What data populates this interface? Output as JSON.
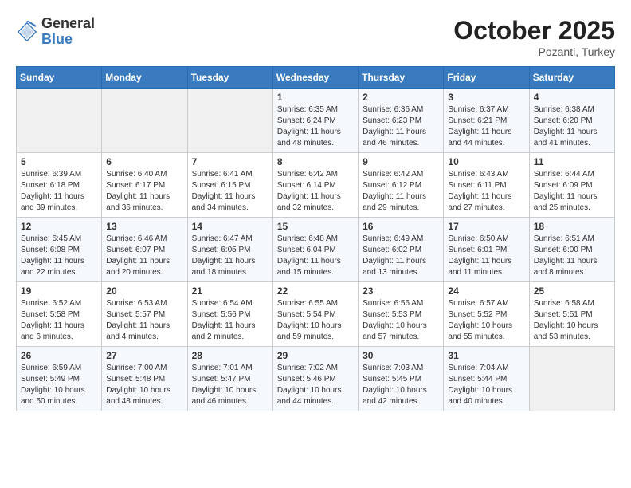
{
  "header": {
    "logo_line1": "General",
    "logo_line2": "Blue",
    "month_title": "October 2025",
    "subtitle": "Pozanti, Turkey"
  },
  "days_of_week": [
    "Sunday",
    "Monday",
    "Tuesday",
    "Wednesday",
    "Thursday",
    "Friday",
    "Saturday"
  ],
  "weeks": [
    [
      {
        "day": "",
        "info": ""
      },
      {
        "day": "",
        "info": ""
      },
      {
        "day": "",
        "info": ""
      },
      {
        "day": "1",
        "info": "Sunrise: 6:35 AM\nSunset: 6:24 PM\nDaylight: 11 hours\nand 48 minutes."
      },
      {
        "day": "2",
        "info": "Sunrise: 6:36 AM\nSunset: 6:23 PM\nDaylight: 11 hours\nand 46 minutes."
      },
      {
        "day": "3",
        "info": "Sunrise: 6:37 AM\nSunset: 6:21 PM\nDaylight: 11 hours\nand 44 minutes."
      },
      {
        "day": "4",
        "info": "Sunrise: 6:38 AM\nSunset: 6:20 PM\nDaylight: 11 hours\nand 41 minutes."
      }
    ],
    [
      {
        "day": "5",
        "info": "Sunrise: 6:39 AM\nSunset: 6:18 PM\nDaylight: 11 hours\nand 39 minutes."
      },
      {
        "day": "6",
        "info": "Sunrise: 6:40 AM\nSunset: 6:17 PM\nDaylight: 11 hours\nand 36 minutes."
      },
      {
        "day": "7",
        "info": "Sunrise: 6:41 AM\nSunset: 6:15 PM\nDaylight: 11 hours\nand 34 minutes."
      },
      {
        "day": "8",
        "info": "Sunrise: 6:42 AM\nSunset: 6:14 PM\nDaylight: 11 hours\nand 32 minutes."
      },
      {
        "day": "9",
        "info": "Sunrise: 6:42 AM\nSunset: 6:12 PM\nDaylight: 11 hours\nand 29 minutes."
      },
      {
        "day": "10",
        "info": "Sunrise: 6:43 AM\nSunset: 6:11 PM\nDaylight: 11 hours\nand 27 minutes."
      },
      {
        "day": "11",
        "info": "Sunrise: 6:44 AM\nSunset: 6:09 PM\nDaylight: 11 hours\nand 25 minutes."
      }
    ],
    [
      {
        "day": "12",
        "info": "Sunrise: 6:45 AM\nSunset: 6:08 PM\nDaylight: 11 hours\nand 22 minutes."
      },
      {
        "day": "13",
        "info": "Sunrise: 6:46 AM\nSunset: 6:07 PM\nDaylight: 11 hours\nand 20 minutes."
      },
      {
        "day": "14",
        "info": "Sunrise: 6:47 AM\nSunset: 6:05 PM\nDaylight: 11 hours\nand 18 minutes."
      },
      {
        "day": "15",
        "info": "Sunrise: 6:48 AM\nSunset: 6:04 PM\nDaylight: 11 hours\nand 15 minutes."
      },
      {
        "day": "16",
        "info": "Sunrise: 6:49 AM\nSunset: 6:02 PM\nDaylight: 11 hours\nand 13 minutes."
      },
      {
        "day": "17",
        "info": "Sunrise: 6:50 AM\nSunset: 6:01 PM\nDaylight: 11 hours\nand 11 minutes."
      },
      {
        "day": "18",
        "info": "Sunrise: 6:51 AM\nSunset: 6:00 PM\nDaylight: 11 hours\nand 8 minutes."
      }
    ],
    [
      {
        "day": "19",
        "info": "Sunrise: 6:52 AM\nSunset: 5:58 PM\nDaylight: 11 hours\nand 6 minutes."
      },
      {
        "day": "20",
        "info": "Sunrise: 6:53 AM\nSunset: 5:57 PM\nDaylight: 11 hours\nand 4 minutes."
      },
      {
        "day": "21",
        "info": "Sunrise: 6:54 AM\nSunset: 5:56 PM\nDaylight: 11 hours\nand 2 minutes."
      },
      {
        "day": "22",
        "info": "Sunrise: 6:55 AM\nSunset: 5:54 PM\nDaylight: 10 hours\nand 59 minutes."
      },
      {
        "day": "23",
        "info": "Sunrise: 6:56 AM\nSunset: 5:53 PM\nDaylight: 10 hours\nand 57 minutes."
      },
      {
        "day": "24",
        "info": "Sunrise: 6:57 AM\nSunset: 5:52 PM\nDaylight: 10 hours\nand 55 minutes."
      },
      {
        "day": "25",
        "info": "Sunrise: 6:58 AM\nSunset: 5:51 PM\nDaylight: 10 hours\nand 53 minutes."
      }
    ],
    [
      {
        "day": "26",
        "info": "Sunrise: 6:59 AM\nSunset: 5:49 PM\nDaylight: 10 hours\nand 50 minutes."
      },
      {
        "day": "27",
        "info": "Sunrise: 7:00 AM\nSunset: 5:48 PM\nDaylight: 10 hours\nand 48 minutes."
      },
      {
        "day": "28",
        "info": "Sunrise: 7:01 AM\nSunset: 5:47 PM\nDaylight: 10 hours\nand 46 minutes."
      },
      {
        "day": "29",
        "info": "Sunrise: 7:02 AM\nSunset: 5:46 PM\nDaylight: 10 hours\nand 44 minutes."
      },
      {
        "day": "30",
        "info": "Sunrise: 7:03 AM\nSunset: 5:45 PM\nDaylight: 10 hours\nand 42 minutes."
      },
      {
        "day": "31",
        "info": "Sunrise: 7:04 AM\nSunset: 5:44 PM\nDaylight: 10 hours\nand 40 minutes."
      },
      {
        "day": "",
        "info": ""
      }
    ]
  ]
}
